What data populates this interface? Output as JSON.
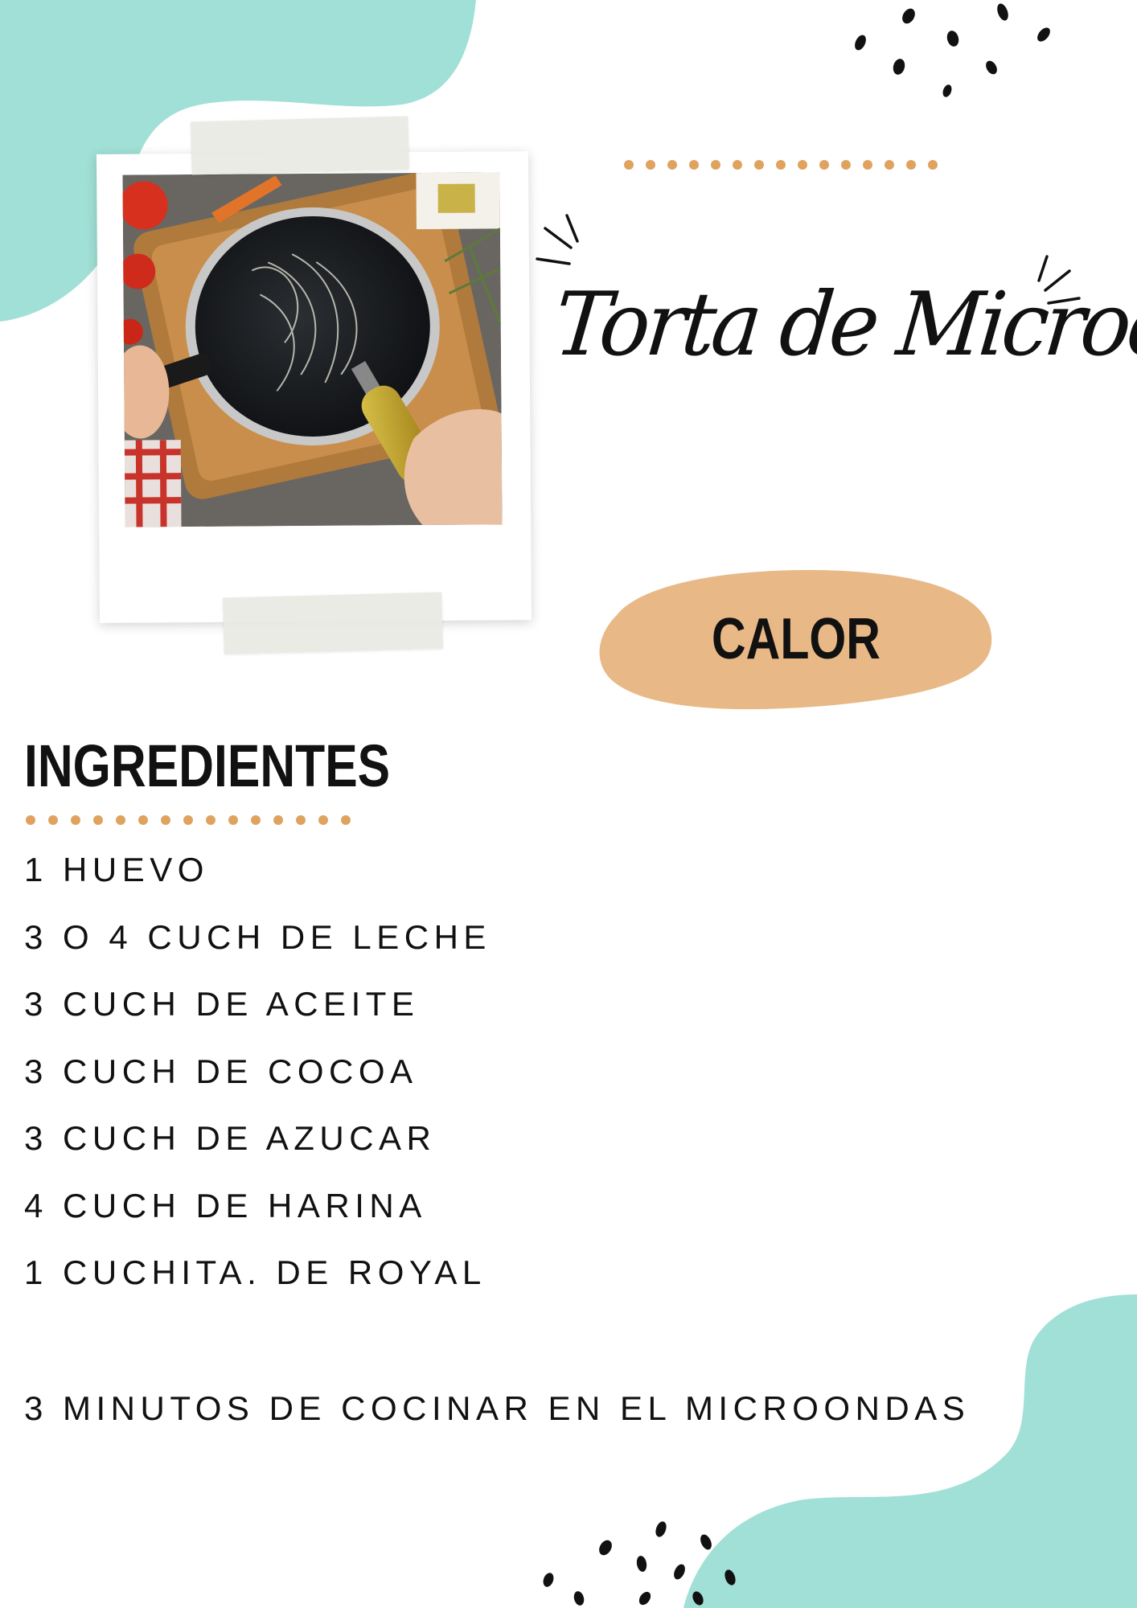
{
  "colors": {
    "mint_blob": "#a1e0d6",
    "dots_orange": "#e0a35f",
    "badge_fill": "#e8b986",
    "text": "#111111"
  },
  "recipe": {
    "title": "Torta de Microondas",
    "badge": "CALOR",
    "ingredients_heading": "INGREDIENTES",
    "ingredients": [
      "1 HUEVO",
      "3 O 4 CUCH DE LECHE",
      "3 CUCH DE ACEITE",
      "3 CUCH DE COCOA",
      "3 CUCH DE AZUCAR",
      "4 CUCH DE HARINA",
      "1 CUCHITA. DE ROYAL"
    ],
    "instruction": "3 MINUTOS DE COCINAR EN EL MICROONDAS"
  },
  "photo": {
    "subject": "pan-with-oil-photo"
  }
}
